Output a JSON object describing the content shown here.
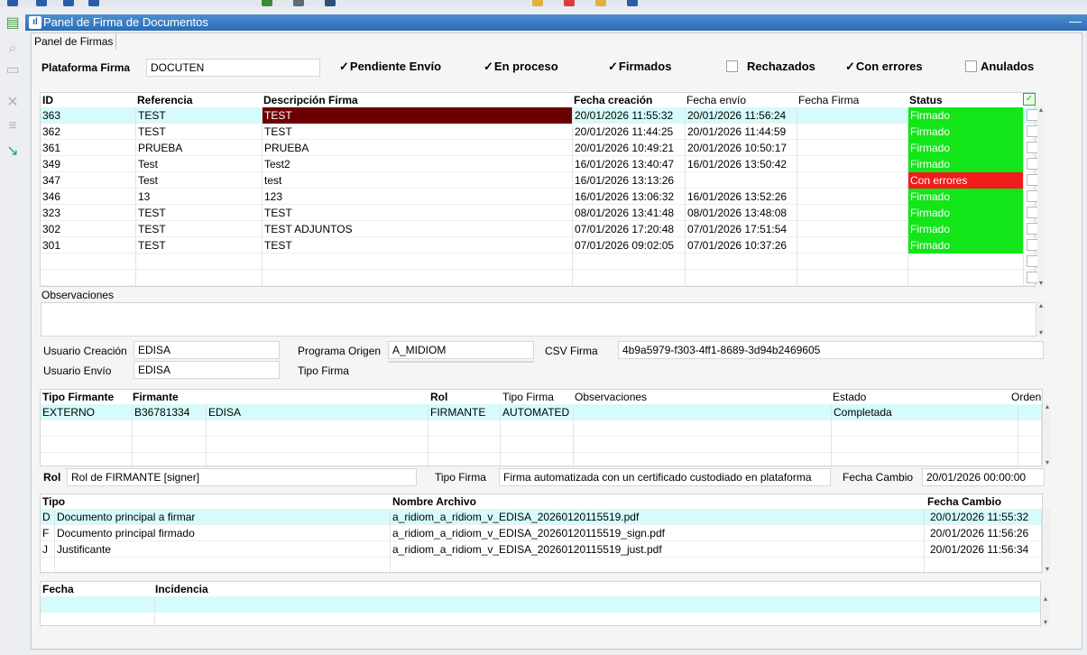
{
  "window": {
    "title": "Panel de Firma de Documentos",
    "tab": "Panel de Firmas",
    "minimize_icon": "minimize-icon"
  },
  "filters": {
    "platform_label": "Plataforma Firma",
    "platform_value": "DOCUTEN",
    "checks": [
      {
        "label": "Pendiente Envío",
        "checked": true
      },
      {
        "label": "En proceso",
        "checked": true
      },
      {
        "label": "Firmados",
        "checked": true
      },
      {
        "label": "Rechazados",
        "checked": false
      },
      {
        "label": "Con errores",
        "checked": true
      },
      {
        "label": "Anulados",
        "checked": false
      }
    ]
  },
  "main_table": {
    "headers": [
      "ID",
      "Referencia",
      "Descripción Firma",
      "Fecha creación",
      "Fecha envío",
      "Fecha Firma",
      "Status"
    ],
    "rows": [
      [
        "363",
        "TEST",
        "TEST",
        "20/01/2026 11:55:32",
        "20/01/2026 11:56:24",
        "",
        "Firmado"
      ],
      [
        "362",
        "TEST",
        "TEST",
        "20/01/2026 11:44:25",
        "20/01/2026 11:44:59",
        "",
        "Firmado"
      ],
      [
        "361",
        "PRUEBA",
        "PRUEBA",
        "20/01/2026 10:49:21",
        "20/01/2026 10:50:17",
        "",
        "Firmado"
      ],
      [
        "349",
        "Test",
        "Test2",
        "16/01/2026 13:40:47",
        "16/01/2026 13:50:42",
        "",
        "Firmado"
      ],
      [
        "347",
        "Test",
        "test",
        "16/01/2026 13:13:26",
        "",
        "",
        "Con errores"
      ],
      [
        "346",
        "13",
        "123",
        "16/01/2026 13:06:32",
        "16/01/2026 13:52:26",
        "",
        "Firmado"
      ],
      [
        "323",
        "TEST",
        "TEST",
        "08/01/2026 13:41:48",
        "08/01/2026 13:48:08",
        "",
        "Firmado"
      ],
      [
        "302",
        "TEST",
        "TEST ADJUNTOS",
        "07/01/2026 17:20:48",
        "07/01/2026 17:51:54",
        "",
        "Firmado"
      ],
      [
        "301",
        "TEST",
        "TEST",
        "07/01/2026 09:02:05",
        "07/01/2026 10:37:26",
        "",
        "Firmado"
      ]
    ],
    "colors": {
      "ok": "#12e619",
      "error": "#f21b1b",
      "selected_desc": "#6b0000",
      "selected_row": "#d5fbfb"
    }
  },
  "observaciones": {
    "label": "Observaciones",
    "value": ""
  },
  "details": {
    "usuario_creacion_label": "Usuario Creación",
    "usuario_creacion": "EDISA",
    "usuario_envio_label": "Usuario Envío",
    "usuario_envio": "EDISA",
    "programa_origen_label": "Programa Origen",
    "programa_origen": "A_MIDIOM",
    "tipo_firma_label": "Tipo Firma",
    "tipo_firma": "",
    "csv_label": "CSV Firma",
    "csv": "4b9a5979-f303-4ff1-8689-3d94b2469605"
  },
  "signers_table": {
    "headers": [
      "Tipo Firmante",
      "Firmante",
      "Rol",
      "Tipo Firma",
      "Observaciones",
      "Estado",
      "Orden"
    ],
    "rows": [
      [
        "EXTERNO",
        "B36781334",
        "EDISA",
        "FIRMANTE",
        "AUTOMATED",
        "",
        "Completada",
        ""
      ]
    ]
  },
  "signer_detail": {
    "rol_label": "Rol",
    "rol_value": "Rol de FIRMANTE [signer]",
    "tipo_firma_label": "Tipo Firma",
    "tipo_firma_value": "Firma automatizada con un certificado custodiado en plataforma",
    "fecha_cambio_label": "Fecha Cambio",
    "fecha_cambio_value": "20/01/2026 00:00:00"
  },
  "files_table": {
    "headers": [
      "Tipo",
      "Nombre Archivo",
      "Fecha Cambio"
    ],
    "rows": [
      [
        "D",
        "Documento principal a firmar",
        "a_ridiom_a_ridiom_v_EDISA_20260120115519.pdf",
        "20/01/2026 11:55:32"
      ],
      [
        "F",
        "Documento principal firmado",
        "a_ridiom_a_ridiom_v_EDISA_20260120115519_sign.pdf",
        "20/01/2026 11:56:26"
      ],
      [
        "J",
        "Justificante",
        "a_ridiom_a_ridiom_v_EDISA_20260120115519_just.pdf",
        "20/01/2026 11:56:34"
      ]
    ]
  },
  "incidents_table": {
    "headers": [
      "Fecha",
      "Incidencia"
    ],
    "rows": []
  }
}
